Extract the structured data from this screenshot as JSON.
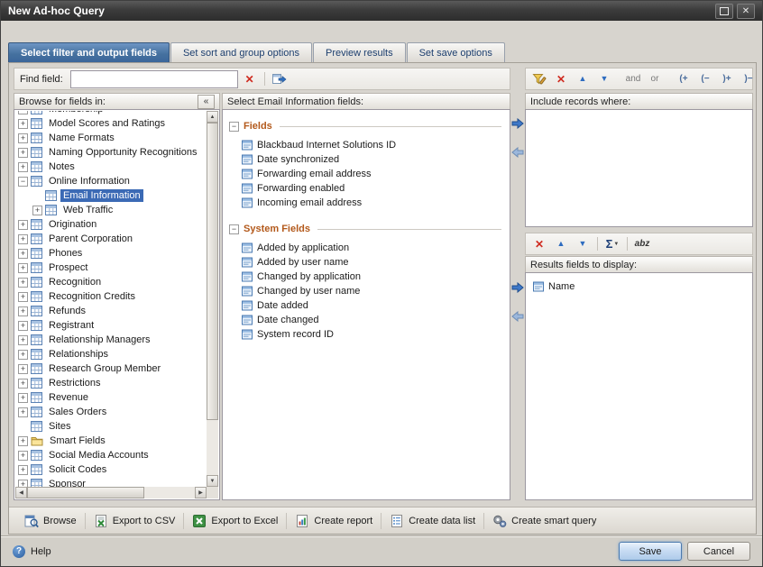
{
  "window": {
    "title": "New Ad-hoc Query"
  },
  "glyphs": {
    "close": "✕",
    "delete": "✕",
    "move_up": "▲",
    "move_down": "▼",
    "scroll_up": "▲",
    "scroll_down": "▼",
    "scroll_left": "◀",
    "scroll_right": "▶",
    "collapse_panel": "«",
    "collapse_group": "−",
    "sigma": "Σ",
    "sigma_caret": "▼",
    "rename": "abz",
    "help": "?"
  },
  "tabs": [
    {
      "label": "Select filter and output fields",
      "active": true
    },
    {
      "label": "Set sort and group options"
    },
    {
      "label": "Preview results"
    },
    {
      "label": "Set save options"
    }
  ],
  "find": {
    "label": "Find field:",
    "value": ""
  },
  "browse_panel": {
    "header": "Browse for fields in:",
    "tree": [
      {
        "label": "Membership",
        "glyph": "+",
        "clip": true
      },
      {
        "label": "Model Scores and Ratings",
        "glyph": "+"
      },
      {
        "label": "Name Formats",
        "glyph": "+"
      },
      {
        "label": "Naming Opportunity Recognitions",
        "glyph": "+"
      },
      {
        "label": "Notes",
        "glyph": "+"
      },
      {
        "label": "Online Information",
        "glyph": "−"
      },
      {
        "label": "Email Information",
        "glyph": "",
        "leaf": true,
        "indent": true,
        "selected": true
      },
      {
        "label": "Web Traffic",
        "glyph": "+",
        "indent": true
      },
      {
        "label": "Origination",
        "glyph": "+"
      },
      {
        "label": "Parent Corporation",
        "glyph": "+"
      },
      {
        "label": "Phones",
        "glyph": "+"
      },
      {
        "label": "Prospect",
        "glyph": "+"
      },
      {
        "label": "Recognition",
        "glyph": "+"
      },
      {
        "label": "Recognition Credits",
        "glyph": "+"
      },
      {
        "label": "Refunds",
        "glyph": "+"
      },
      {
        "label": "Registrant",
        "glyph": "+"
      },
      {
        "label": "Relationship Managers",
        "glyph": "+"
      },
      {
        "label": "Relationships",
        "glyph": "+"
      },
      {
        "label": "Research Group Member",
        "glyph": "+"
      },
      {
        "label": "Restrictions",
        "glyph": "+"
      },
      {
        "label": "Revenue",
        "glyph": "+"
      },
      {
        "label": "Sales Orders",
        "glyph": "+"
      },
      {
        "label": "Sites",
        "glyph": "",
        "leaf": true
      },
      {
        "label": "Smart Fields",
        "glyph": "+",
        "folder": true
      },
      {
        "label": "Social Media Accounts",
        "glyph": "+"
      },
      {
        "label": "Solicit Codes",
        "glyph": "+"
      },
      {
        "label": "Sponsor",
        "glyph": "+"
      }
    ]
  },
  "fields_panel": {
    "header": "Select Email Information fields:",
    "groups": [
      {
        "label": "Fields",
        "items": [
          {
            "label": "Blackbaud Internet Solutions ID"
          },
          {
            "label": "Date synchronized"
          },
          {
            "label": "Forwarding email address"
          },
          {
            "label": "Forwarding enabled"
          },
          {
            "label": "Incoming email address"
          }
        ]
      },
      {
        "label": "System Fields",
        "items": [
          {
            "label": "Added by application"
          },
          {
            "label": "Added by user name"
          },
          {
            "label": "Changed by application"
          },
          {
            "label": "Changed by user name"
          },
          {
            "label": "Date added"
          },
          {
            "label": "Date changed"
          },
          {
            "label": "System record ID"
          }
        ]
      }
    ]
  },
  "include_panel": {
    "header": "Include records where:"
  },
  "include_toolbar": {
    "and_label": "and",
    "or_label": "or",
    "open_add": "(+",
    "open_remove": "(−",
    "close_add": ")+",
    "close_remove": ")−"
  },
  "results_panel": {
    "header": "Results fields to display:",
    "items": [
      {
        "label": "Name"
      }
    ]
  },
  "actions": [
    {
      "label": "Browse"
    },
    {
      "label": "Export to CSV"
    },
    {
      "label": "Export to Excel"
    },
    {
      "label": "Create report"
    },
    {
      "label": "Create data list"
    },
    {
      "label": "Create smart query"
    }
  ],
  "footer": {
    "help": "Help",
    "save": "Save",
    "cancel": "Cancel"
  }
}
